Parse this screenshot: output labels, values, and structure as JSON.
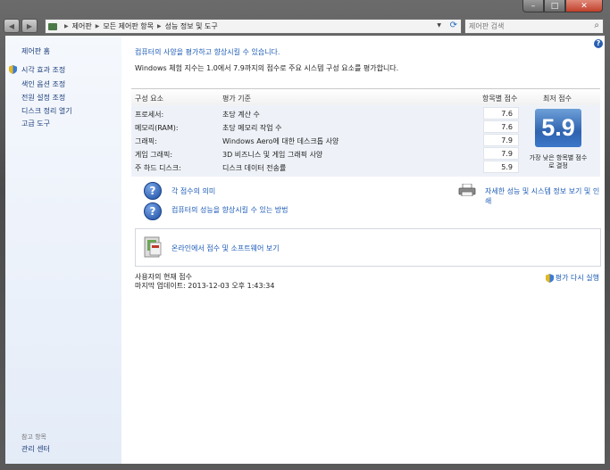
{
  "window": {
    "caption_buttons": {
      "minimize": "–",
      "maximize": "□",
      "close": "✕"
    }
  },
  "nav": {
    "breadcrumbs": [
      "제어판",
      "모든 제어판 항목",
      "성능 정보 및 도구"
    ],
    "search_placeholder": "제어판 검색"
  },
  "left_pane": {
    "home": "제어판 홈",
    "items": [
      "시각 효과 조정",
      "색인 옵션 조정",
      "전원 설정 조정",
      "디스크 정리 열기",
      "고급 도구"
    ],
    "see_also_heading": "참고 항목",
    "see_also_items": [
      "관리 센터"
    ]
  },
  "main": {
    "title": "컴퓨터의 사양을 평가하고 향상시킬 수 있습니다.",
    "description": "Windows 체험 지수는 1.0에서 7.9까지의 점수로 주요 시스템 구성 요소를 평가합니다.",
    "table": {
      "headers": {
        "component": "구성 요소",
        "rated": "평가 기준",
        "subscore": "항목별 점수",
        "base": "최저 점수"
      },
      "rows": [
        {
          "component": "프로세서:",
          "rated": "초당 계산 수",
          "subscore": "7.6"
        },
        {
          "component": "메모리(RAM):",
          "rated": "초당 메모리 작업 수",
          "subscore": "7.6"
        },
        {
          "component": "그래픽:",
          "rated": "Windows Aero에 대한 데스크톱 사양",
          "subscore": "7.9"
        },
        {
          "component": "게임 그래픽:",
          "rated": "3D 비즈니스 및 게임 그래픽 사양",
          "subscore": "7.9"
        },
        {
          "component": "주 하드 디스크:",
          "rated": "디스크 데이터 전송률",
          "subscore": "5.9"
        }
      ],
      "base_score": "5.9",
      "base_caption": "가장 낮은 항목별 점수로 결정"
    },
    "links": {
      "meaning": "각 점수의 의미",
      "improve": "컴퓨터의 성능을 향상시킬 수 있는 방법",
      "detailed": "자세한 성능 및 시스템 정보 보기 및 인쇄",
      "online": "온라인에서 점수 및 소프트웨어 보기"
    },
    "status": {
      "current": "사용자의 현재 점수",
      "last_update": "마지막 업데이트: 2013-12-03 오후 1:43:34",
      "rerun": "평가 다시 실행"
    }
  }
}
